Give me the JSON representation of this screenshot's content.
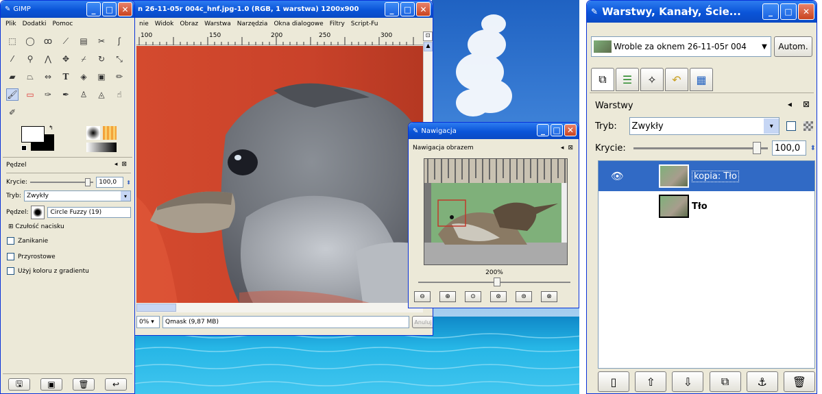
{
  "gimp": {
    "title": "GIMP",
    "menu": [
      "Plik",
      "Dodatki",
      "Pomoc"
    ],
    "tools": [
      "rect-select",
      "ellipse-select",
      "lasso",
      "fuzzy-select",
      "color-select",
      "scissors",
      "paths",
      "color-picker",
      "zoom",
      "measure",
      "move",
      "crop",
      "rotate",
      "scale",
      "shear",
      "perspective",
      "flip",
      "text",
      "bucket-fill",
      "blend",
      "pencil",
      "paintbrush",
      "eraser",
      "airbrush",
      "ink",
      "clone",
      "heal",
      "smudge",
      "dodge"
    ],
    "brush_panel": {
      "title": "Pędzel",
      "opacity_label": "Krycie:",
      "opacity_value": "100,0",
      "mode_label": "Tryb:",
      "mode_value": "Zwykły",
      "brush_label": "Pędzel:",
      "brush_value": "Circle Fuzzy (19)",
      "pressure_label": "Czułość nacisku",
      "checkboxes": [
        "Zanikanie",
        "Przyrostowe",
        "Użyj koloru z gradientu"
      ]
    }
  },
  "image_window": {
    "title": "n 26-11-05r 004c_hnf.jpg-1.0 (RGB, 1 warstwa) 1200x900",
    "menu": [
      "nie",
      "Widok",
      "Obraz",
      "Warstwa",
      "Narzędzia",
      "Okna dialogowe",
      "Filtry",
      "Script-Fu"
    ],
    "ruler_ticks": [
      "100",
      "150",
      "200",
      "250",
      "300"
    ],
    "zoom": "0%",
    "status": "Qmask (9,87 MB)",
    "cancel": "Anuluj"
  },
  "navigation": {
    "title": "Nawigacja",
    "subtitle": "Nawigacja obrazem",
    "zoom_text": "200%"
  },
  "layers": {
    "title": "Warstwy, Kanały, Ście...",
    "image_select": "Wroble za oknem 26-11-05r 004",
    "auto_button": "Autom.",
    "panel_title": "Warstwy",
    "mode_label": "Tryb:",
    "mode_value": "Zwykły",
    "opacity_label": "Krycie:",
    "opacity_value": "100,0",
    "items": [
      {
        "name": "kopia: Tło"
      },
      {
        "name": "Tło"
      }
    ]
  }
}
